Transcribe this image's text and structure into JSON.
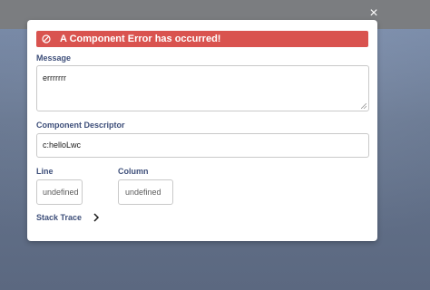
{
  "modal": {
    "close_label": "×",
    "error_title": "A Component Error has occurred!",
    "message_label": "Message",
    "message_value": "errrrrrr",
    "descriptor_label": "Component Descriptor",
    "descriptor_value": "c:helloLwc",
    "line_label": "Line",
    "line_value": "undefined",
    "column_label": "Column",
    "column_value": "undefined",
    "stack_trace_label": "Stack Trace"
  },
  "colors": {
    "error_banner": "#d9534f",
    "label_text": "#3e4f7a",
    "backdrop": "#5e6b80"
  },
  "icons": {
    "banner_icon": "ban-icon",
    "close_icon": "close-icon",
    "expand_icon": "chevron-right-icon"
  }
}
